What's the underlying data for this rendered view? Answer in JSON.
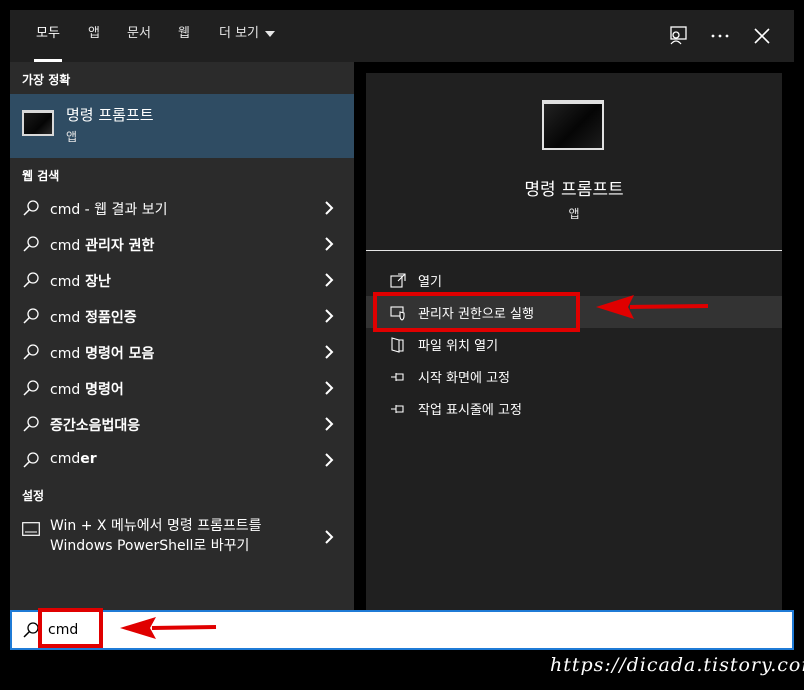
{
  "tabs": [
    {
      "label": "모두"
    },
    {
      "label": "앱"
    },
    {
      "label": "문서"
    },
    {
      "label": "웹"
    },
    {
      "label": "더 보기"
    }
  ],
  "left": {
    "best_header": "가장 정확",
    "best": {
      "title": "명령 프롬프트",
      "subtitle": "앱",
      "icon": "cmd-window-icon"
    },
    "web_header": "웹 검색",
    "web_results": [
      {
        "prefix": "cmd",
        "rest": " - 웹 결과 보기",
        "bold_rest": false
      },
      {
        "prefix": "cmd",
        "rest": " 관리자 권한",
        "bold_rest": true
      },
      {
        "prefix": "cmd",
        "rest": " 장난",
        "bold_rest": true
      },
      {
        "prefix": "cmd",
        "rest": " 정품인증",
        "bold_rest": true
      },
      {
        "prefix": "cmd",
        "rest": " 명령어 모음",
        "bold_rest": true
      },
      {
        "prefix": "cmd",
        "rest": " 명령어",
        "bold_rest": true
      },
      {
        "prefix": "",
        "rest": "증간소음법대응",
        "bold_rest": true
      },
      {
        "prefix": "cmd",
        "rest": "er",
        "bold_rest": true
      }
    ],
    "settings_header": "설정",
    "setting_line1": "Win + X 메뉴에서 명령 프롬프트를",
    "setting_line2": "Windows PowerShell로 바꾸기"
  },
  "right": {
    "title": "명령 프롬프트",
    "subtitle": "앱",
    "actions": [
      {
        "label": "열기",
        "icon": "open-icon"
      },
      {
        "label": "관리자 권한으로 실행",
        "icon": "shield-icon"
      },
      {
        "label": "파일 위치 열기",
        "icon": "file-location-icon"
      },
      {
        "label": "시작 화면에 고정",
        "icon": "pin-icon"
      },
      {
        "label": "작업 표시줄에 고정",
        "icon": "pin-icon"
      }
    ]
  },
  "search": {
    "value": "cmd"
  },
  "watermark": "https://dicada.tistory.com",
  "colors": {
    "accent": "#2f4c63",
    "annotation": "#e00000",
    "focus": "#1f7bd6"
  }
}
